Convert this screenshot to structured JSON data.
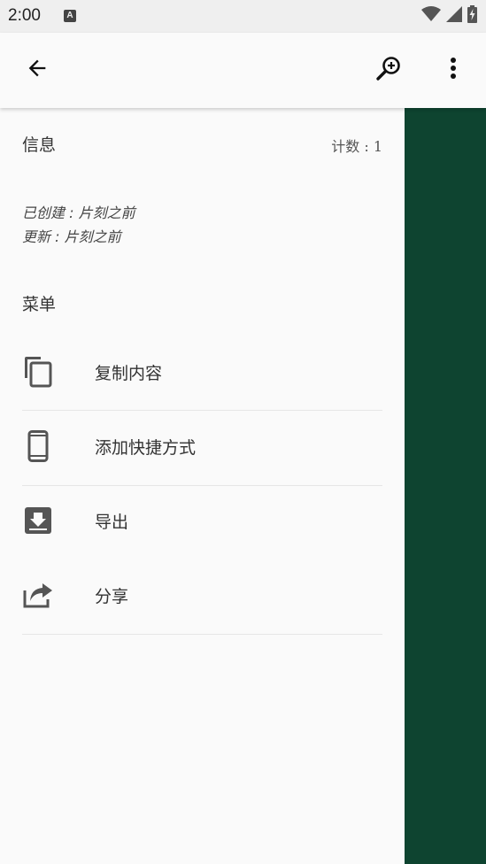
{
  "status_bar": {
    "time": "2:00",
    "notification_letter": "A",
    "icons": [
      "wifi-icon",
      "signal-icon",
      "battery-charging-icon"
    ]
  },
  "toolbar": {
    "back_icon": "arrow-back-icon",
    "zoom_icon": "zoom-in-icon",
    "more_icon": "more-vertical-icon"
  },
  "info": {
    "title": "信息",
    "count": "计数 : 1",
    "created": "已创建 : 片刻之前",
    "updated": "更新 : 片刻之前"
  },
  "menu": {
    "title": "菜单",
    "items": [
      {
        "label": "复制内容",
        "icon": "copy-icon"
      },
      {
        "label": "添加快捷方式",
        "icon": "phone-shortcut-icon"
      },
      {
        "label": "导出",
        "icon": "export-download-icon"
      },
      {
        "label": "分享",
        "icon": "share-icon"
      }
    ]
  },
  "colors": {
    "accent_panel": "#0e4430",
    "background": "#fafafa",
    "status_bar": "#efefef"
  }
}
